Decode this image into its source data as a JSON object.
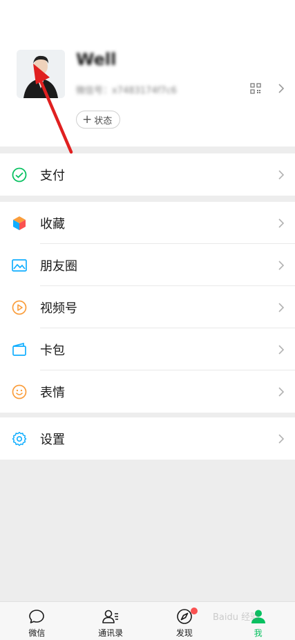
{
  "profile": {
    "nickname": "Well",
    "wxid": "微信号：x7483174f7c6",
    "status_label": "状态"
  },
  "menu": {
    "pay": "支付",
    "favorites": "收藏",
    "moments": "朋友圈",
    "channels": "视频号",
    "cards": "卡包",
    "stickers": "表情",
    "settings": "设置"
  },
  "tabs": {
    "chats": "微信",
    "contacts": "通讯录",
    "discover": "发现",
    "me": "我"
  },
  "watermark": "Baidu 经验",
  "colors": {
    "accent": "#07c160",
    "arrow": "#e02020",
    "badge": "#fa5151"
  }
}
